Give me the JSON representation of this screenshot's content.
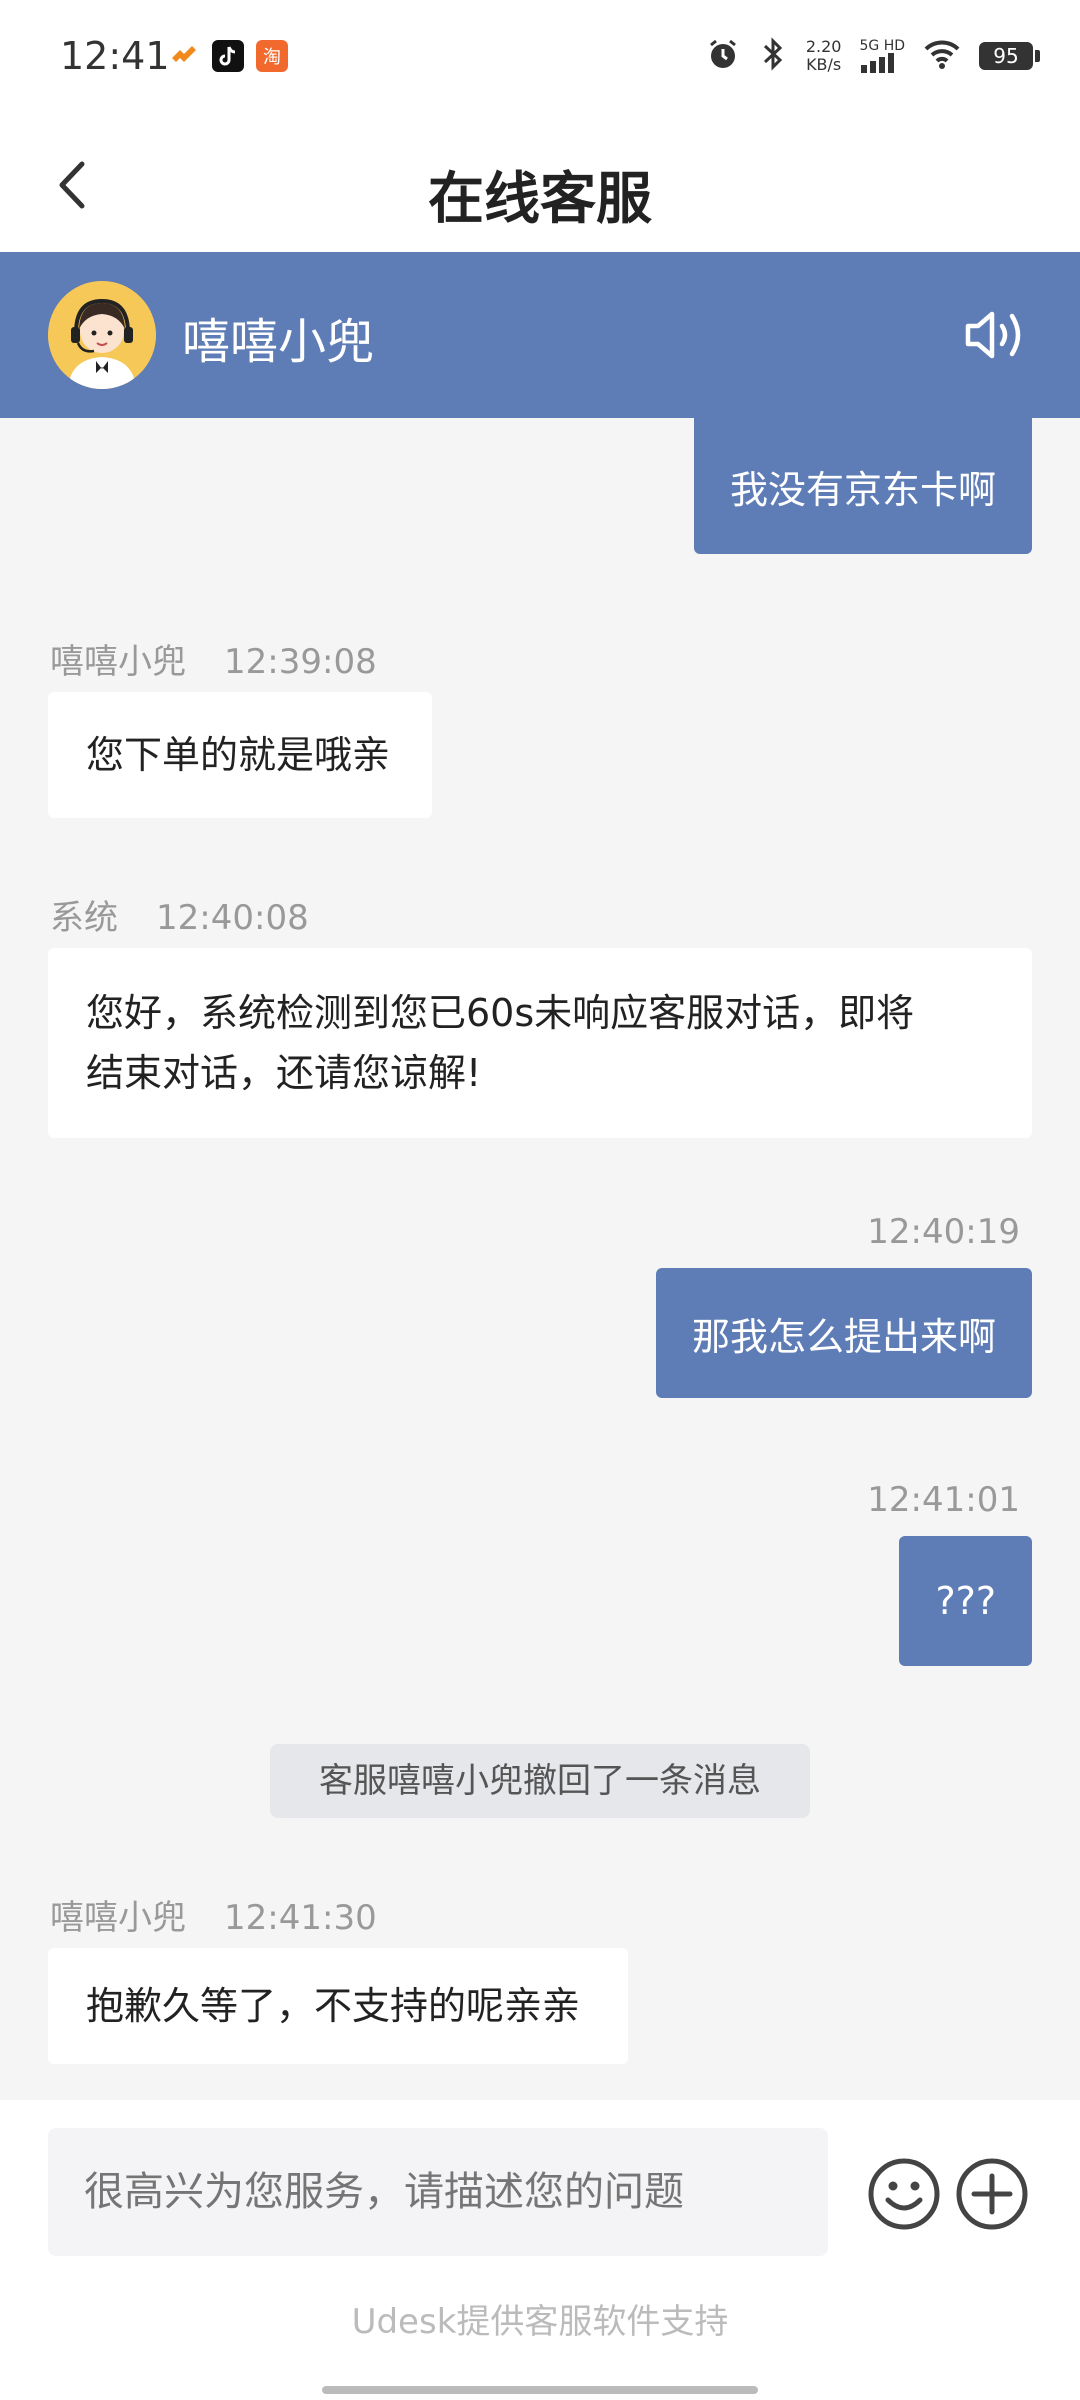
{
  "status_bar": {
    "time": "12:41",
    "net_speed_value": "2.20",
    "net_speed_unit": "KB/s",
    "network": "5G HD",
    "battery": "95",
    "apps": [
      "swoosh-app-icon",
      "tiktok-icon",
      "taobao-icon"
    ]
  },
  "header": {
    "title": "在线客服"
  },
  "agent": {
    "name": "嘻嘻小兜"
  },
  "messages": [
    {
      "side": "right",
      "text": "我没有京东卡啊"
    },
    {
      "side": "left",
      "sender": "嘻嘻小兜",
      "time": "12:39:08",
      "text": "您下单的就是哦亲"
    },
    {
      "side": "left",
      "sender": "系统",
      "time": "12:40:08",
      "text_line1": "您好，系统检测到您已60s未响应客服对话，即将",
      "text_line2": "结束对话，还请您谅解!"
    },
    {
      "side": "right",
      "time": "12:40:19",
      "text": "那我怎么提出来啊"
    },
    {
      "side": "right",
      "time": "12:41:01",
      "text": "???"
    },
    {
      "side": "notice",
      "text": "客服嘻嘻小兜撤回了一条消息"
    },
    {
      "side": "left",
      "sender": "嘻嘻小兜",
      "time": "12:41:30",
      "text": "抱歉久等了，不支持的呢亲亲"
    }
  ],
  "input": {
    "placeholder": "很高兴为您服务，请描述您的问题"
  },
  "footer": {
    "powered_by": "Udesk提供客服软件支持"
  },
  "colors": {
    "accent": "#5e7db6",
    "background": "#f5f5f5"
  }
}
